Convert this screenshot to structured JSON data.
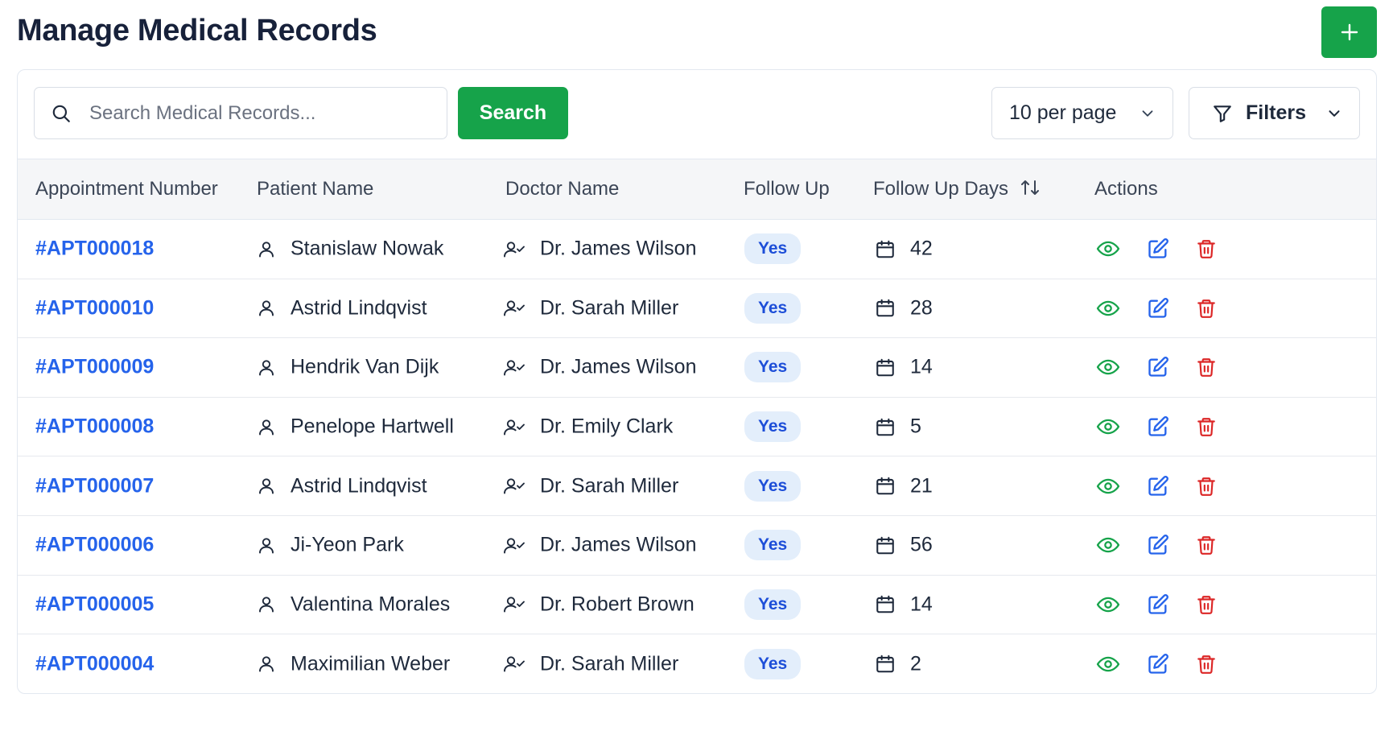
{
  "page": {
    "title": "Manage Medical Records"
  },
  "toolbar": {
    "add_icon": "plus-icon",
    "search_placeholder": "Search Medical Records...",
    "search_button_label": "Search",
    "per_page_value": "10 per page",
    "filters_label": "Filters"
  },
  "colors": {
    "primary_green": "#16a34a",
    "link_blue": "#2563eb",
    "danger_red": "#dc2626",
    "badge_bg": "#e3eefb"
  },
  "table": {
    "headers": {
      "appointment_number": "Appointment Number",
      "patient_name": "Patient Name",
      "doctor_name": "Doctor Name",
      "follow_up": "Follow Up",
      "follow_up_days": "Follow Up Days",
      "actions": "Actions"
    },
    "rows": [
      {
        "appointment": "#APT000018",
        "patient": "Stanislaw Nowak",
        "doctor": "Dr. James Wilson",
        "follow_up": "Yes",
        "days": "42"
      },
      {
        "appointment": "#APT000010",
        "patient": "Astrid Lindqvist",
        "doctor": "Dr. Sarah Miller",
        "follow_up": "Yes",
        "days": "28"
      },
      {
        "appointment": "#APT000009",
        "patient": "Hendrik Van Dijk",
        "doctor": "Dr. James Wilson",
        "follow_up": "Yes",
        "days": "14"
      },
      {
        "appointment": "#APT000008",
        "patient": "Penelope Hartwell",
        "doctor": "Dr. Emily Clark",
        "follow_up": "Yes",
        "days": "5"
      },
      {
        "appointment": "#APT000007",
        "patient": "Astrid Lindqvist",
        "doctor": "Dr. Sarah Miller",
        "follow_up": "Yes",
        "days": "21"
      },
      {
        "appointment": "#APT000006",
        "patient": "Ji-Yeon Park",
        "doctor": "Dr. James Wilson",
        "follow_up": "Yes",
        "days": "56"
      },
      {
        "appointment": "#APT000005",
        "patient": "Valentina Morales",
        "doctor": "Dr. Robert Brown",
        "follow_up": "Yes",
        "days": "14"
      },
      {
        "appointment": "#APT000004",
        "patient": "Maximilian Weber",
        "doctor": "Dr. Sarah Miller",
        "follow_up": "Yes",
        "days": "2"
      }
    ]
  }
}
